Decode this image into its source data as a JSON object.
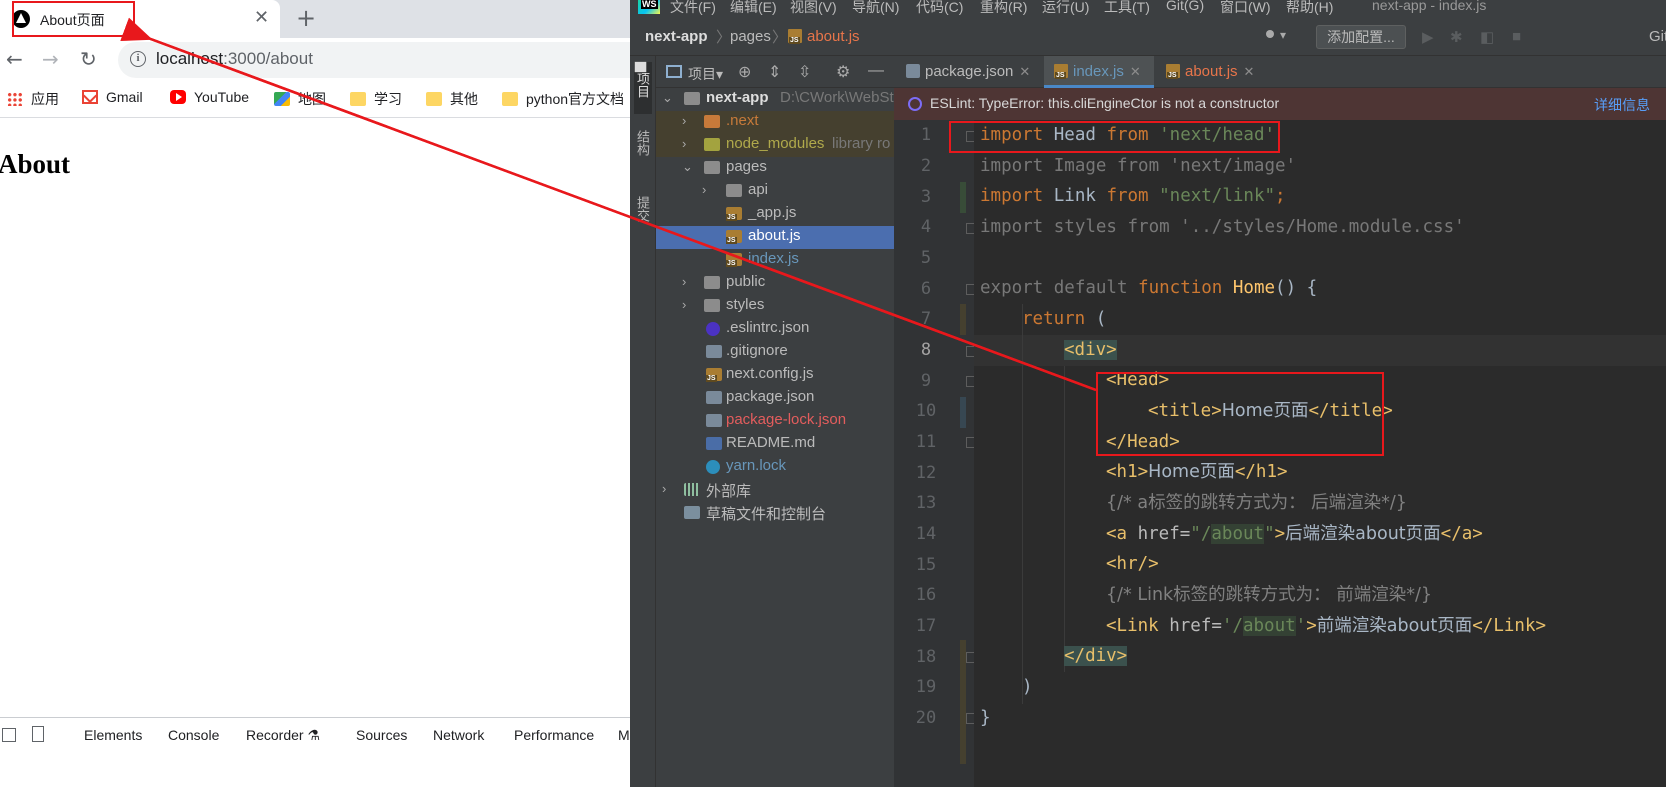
{
  "browser": {
    "tab_title": "About页面",
    "url_host": "localhost",
    "url_rest": ":3000/about",
    "bookmarks": [
      "应用",
      "Gmail",
      "YouTube",
      "地图",
      "学习",
      "其他",
      "python官方文档"
    ],
    "page_heading": "About",
    "devtools_tabs": [
      "Elements",
      "Console",
      "Recorder",
      "Sources",
      "Network",
      "Performance",
      "M"
    ]
  },
  "ide": {
    "menu": [
      "文件(F)",
      "编辑(E)",
      "视图(V)",
      "导航(N)",
      "代码(C)",
      "重构(R)",
      "运行(U)",
      "工具(T)",
      "Git(G)",
      "窗口(W)",
      "帮助(H)"
    ],
    "window_title": "next-app - index.js",
    "breadcrumb": [
      "next-app",
      "pages",
      "about.js"
    ],
    "add_config": "添加配置...",
    "git_label": "Git",
    "side_tabs": [
      "项目",
      "结构",
      "提交"
    ],
    "project_label": "项目",
    "tree": [
      {
        "label": "next-app",
        "extra": "D:\\CWork\\WebSt"
      },
      {
        "label": ".next",
        "extra": ""
      },
      {
        "label": "node_modules",
        "extra": "library ro"
      },
      {
        "label": "pages",
        "extra": ""
      },
      {
        "label": "api",
        "extra": ""
      },
      {
        "label": "_app.js",
        "extra": ""
      },
      {
        "label": "about.js",
        "extra": ""
      },
      {
        "label": "index.js",
        "extra": ""
      },
      {
        "label": "public",
        "extra": ""
      },
      {
        "label": "styles",
        "extra": ""
      },
      {
        "label": ".eslintrc.json",
        "extra": ""
      },
      {
        "label": ".gitignore",
        "extra": ""
      },
      {
        "label": "next.config.js",
        "extra": ""
      },
      {
        "label": "package.json",
        "extra": ""
      },
      {
        "label": "package-lock.json",
        "extra": ""
      },
      {
        "label": "README.md",
        "extra": ""
      },
      {
        "label": "yarn.lock",
        "extra": ""
      },
      {
        "label": "外部库",
        "extra": ""
      },
      {
        "label": "草稿文件和控制台",
        "extra": ""
      }
    ],
    "editor_tabs": [
      "package.json",
      "index.js",
      "about.js"
    ],
    "eslint_message": "ESLint: TypeError: this.cliEngineCtor is not a constructor",
    "eslint_link": "详细信息",
    "line_numbers": [
      "1",
      "2",
      "3",
      "4",
      "5",
      "6",
      "7",
      "8",
      "9",
      "10",
      "11",
      "12",
      "13",
      "14",
      "15",
      "16",
      "17",
      "18",
      "19",
      "20"
    ],
    "code": {
      "l1a": "import",
      "l1b": " Head ",
      "l1c": "from",
      "l1d": " 'next/head'",
      "l2": "import Image from 'next/image'",
      "l3a": "import",
      "l3b": " Link ",
      "l3c": "from",
      "l3d": " \"next/link\"",
      "l3e": ";",
      "l4": "import styles from '../styles/Home.module.css'",
      "l6a": "export default ",
      "l6b": "function",
      "l6c": " Home",
      "l6d": "() {",
      "l7a": "return",
      "l7b": " (",
      "l8": "<div>",
      "l9": "<Head>",
      "l10a": "<title>",
      "l10b": "Home页面",
      "l10c": "</title>",
      "l11": "</Head>",
      "l12a": "<h1>",
      "l12b": "Home页面",
      "l12c": "</h1>",
      "l13": "{/* a标签的跳转方式为： 后端渲染*/}",
      "l14a": "<a ",
      "l14b": "href=",
      "l14c": "\"/",
      "l14d": "about",
      "l14e": "\"",
      "l14f": ">",
      "l14g": "后端渲染about页面",
      "l14h": "</a>",
      "l15": "<hr/>",
      "l16": "{/* Link标签的跳转方式为： 前端渲染*/}",
      "l17a": "<Link ",
      "l17b": "href=",
      "l17c": "'/",
      "l17d": "about",
      "l17e": "'",
      "l17f": ">",
      "l17g": "前端渲染about页面",
      "l17h": "</Link>",
      "l18": "</div>",
      "l19": ")",
      "l20": "}"
    }
  },
  "colors": {
    "annotation_red": "#e8181c",
    "ide_bg": "#2b2b2b",
    "selection": "#4b6eaf"
  }
}
